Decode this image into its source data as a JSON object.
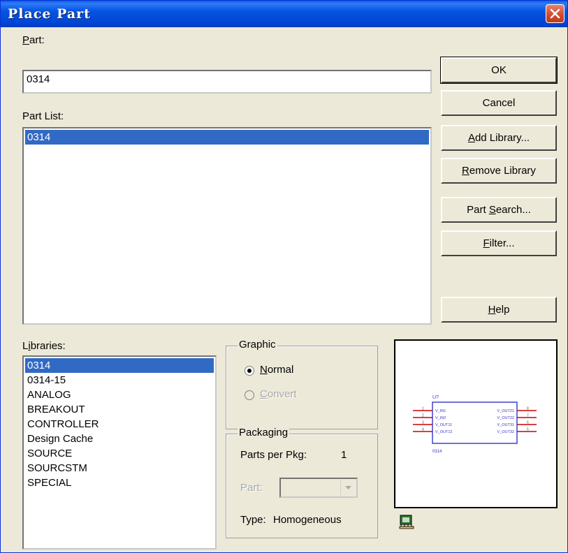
{
  "window": {
    "title": "Place Part"
  },
  "part": {
    "label": "Part:",
    "value": "0314"
  },
  "part_list": {
    "label": "Part List:",
    "items": [
      "0314"
    ]
  },
  "buttons": {
    "ok": "OK",
    "cancel": "Cancel",
    "add_library": "Add Library...",
    "remove_library": "Remove Library",
    "part_search": "Part Search...",
    "filter": "Filter...",
    "help": "Help"
  },
  "libraries": {
    "label": "Libraries:",
    "items": [
      "0314",
      "0314-15",
      "ANALOG",
      "BREAKOUT",
      "CONTROLLER",
      "Design Cache",
      "SOURCE",
      "SOURCSTM",
      "SPECIAL"
    ]
  },
  "graphic": {
    "title": "Graphic",
    "normal": "Normal",
    "convert": "Convert"
  },
  "packaging": {
    "title": "Packaging",
    "parts_per_pkg_label": "Parts per Pkg:",
    "parts_per_pkg_value": "1",
    "part_label": "Part:",
    "type_label": "Type:",
    "type_value": "Homogeneous"
  },
  "preview": {
    "ref": "U?",
    "value": "0314",
    "pins_left": [
      "V_IN1",
      "V_IN2",
      "V_OUT11",
      "V_OUT12"
    ],
    "pins_right": [
      "V_OUT21",
      "V_OUT22",
      "V_OUT31",
      "V_OUT32"
    ],
    "pin_numbers_left": [
      "1",
      "2",
      "3",
      "4"
    ],
    "pin_numbers_right": [
      "8",
      "7",
      "6",
      "5"
    ]
  },
  "colors": {
    "selection": "#316ac5",
    "titlebar": "#0553e0",
    "schematic_body": "#3333cc",
    "schematic_pin": "#cc0000"
  }
}
